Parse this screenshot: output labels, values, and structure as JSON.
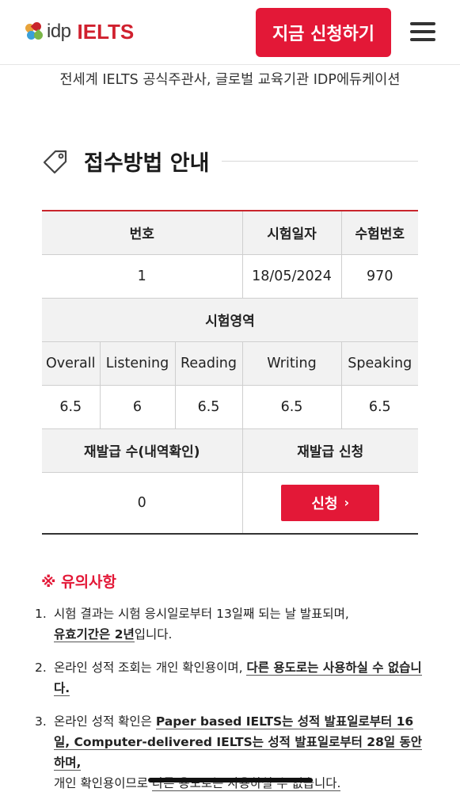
{
  "header": {
    "logo_idp": "idp",
    "logo_ielts": "IELTS",
    "apply_button": "지금 신청하기",
    "menu_icon": "hamburger-menu-icon"
  },
  "tagline": "전세계 IELTS 공식주관사, 글로벌 교육기관 IDP에듀케이션",
  "section": {
    "title": "접수방법 안내",
    "icon": "tag-icon"
  },
  "table": {
    "headers": {
      "number": "번호",
      "test_date": "시험일자",
      "candidate_number": "수험번호"
    },
    "row": {
      "number": "1",
      "test_date": "18/05/2024",
      "candidate_number": "970"
    },
    "area_header": "시험영역",
    "areas": {
      "overall": {
        "label": "Overall",
        "score": "6.5"
      },
      "listening": {
        "label": "Listening",
        "score": "6"
      },
      "reading": {
        "label": "Reading",
        "score": "6.5"
      },
      "writing": {
        "label": "Writing",
        "score": "6.5"
      },
      "speaking": {
        "label": "Speaking",
        "score": "6.5"
      }
    },
    "reissue_count_header": "재발급 수(내역확인)",
    "reissue_apply_header": "재발급 신청",
    "reissue_count": "0",
    "reissue_button": "신청",
    "reissue_button_chevron": "›"
  },
  "notes": {
    "title": "※ 유의사항",
    "items": [
      {
        "num": "1.",
        "a": "시험 결과는 시험 응시일로부터 13일째 되는 날 발표되며,",
        "b": "유효기간은 2년",
        "c": "입니다."
      },
      {
        "num": "2.",
        "a": "온라인 성적 조회는 개인 확인용이며, ",
        "b": "다른 용도로는 사용하실 수 없습니다."
      },
      {
        "num": "3.",
        "a": "온라인 성적 확인은 ",
        "b": "Paper based IELTS는 성적 발표일로부터 16일, Computer-delivered IELTS는 성적 발표일로부터 28일 동안 하며,",
        "c": "개인 확인용이므로 ",
        "d": "다른 용도로는 사용하실 수 없습니다."
      }
    ]
  },
  "colors": {
    "brand_red": "#e31837",
    "logo_red": "#d0202e"
  }
}
